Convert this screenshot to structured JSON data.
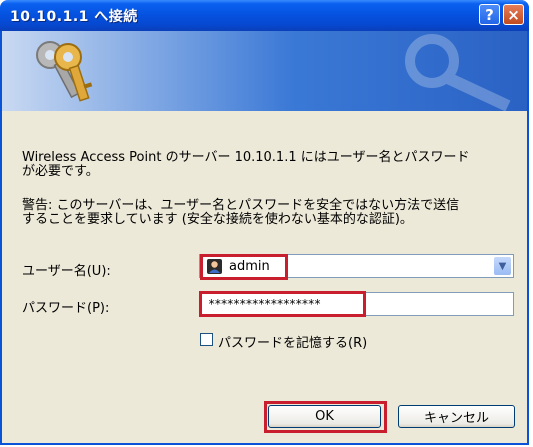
{
  "window": {
    "title": "10.10.1.1 へ接続",
    "help_button": "?",
    "close_button": "×"
  },
  "message": {
    "line1": "Wireless Access Point のサーバー 10.10.1.1 にはユーザー名とパスワード",
    "line2": "が必要です。",
    "warning_line1": "警告: このサーバーは、ユーザー名とパスワードを安全ではない方法で送信",
    "warning_line2": "することを要求しています (安全な接続を使わない基本的な認証)。"
  },
  "form": {
    "username_label": "ユーザー名(U):",
    "username_value": "admin",
    "password_label": "パスワード(P):",
    "password_value": "******************",
    "remember_label": "パスワードを記憶する(R)",
    "remember_checked": false
  },
  "buttons": {
    "ok": "OK",
    "cancel": "キャンセル"
  },
  "colors": {
    "highlight": "#C81E2E",
    "title_bar": "#0553E1",
    "dialog_bg": "#ECE9D8"
  },
  "icons": {
    "banner": "keys-icon",
    "user": "user-icon",
    "dropdown": "chevron-down-icon"
  }
}
